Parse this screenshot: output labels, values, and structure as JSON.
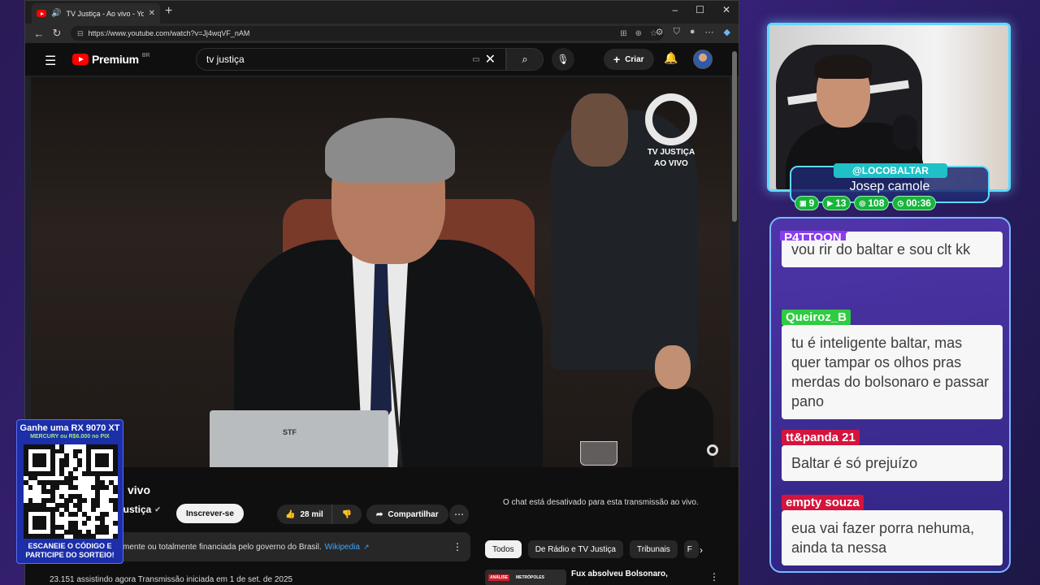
{
  "browser": {
    "tab_title": "TV Justiça - Ao vivo - YouTube",
    "url": "https://www.youtube.com/watch?v=Jj4wqVF_nAM"
  },
  "youtube": {
    "logo_text": "Premium",
    "country": "BR",
    "search_value": "tv justiça",
    "create_label": "Criar",
    "video": {
      "channel_logo_line1": "TV JUSTIÇA",
      "channel_logo_line2": "AO VIVO",
      "laptop_brand": "STF"
    },
    "title_partial": "vivo",
    "channel_name": "Justiça",
    "subscribe_label": "Inscrever-se",
    "likes": "28 mil",
    "share_label": "Compartilhar",
    "info_text": "mente ou totalmente financiada pelo governo do Brasil.",
    "info_link": "Wikipedia",
    "stats_text": "23.151 assistindo agora  Transmissão iniciada em 1 de set. de 2025",
    "chat_disabled": "O chat está desativado para esta transmissão ao vivo.",
    "chips": [
      "Todos",
      "De Rádio e TV Justiça",
      "Tribunais",
      "F"
    ],
    "recommendation": {
      "tag": "ANÁLISE",
      "source": "METRÓPOLES",
      "title": "Fux absolveu Bolsonaro,"
    }
  },
  "overlay": {
    "handle": "@LOCOBALTAR",
    "caption": "Josep camole",
    "stats": [
      {
        "icon": "twitch",
        "value": "9"
      },
      {
        "icon": "youtube",
        "value": "13"
      },
      {
        "icon": "kick",
        "value": "108"
      },
      {
        "icon": "clock",
        "value": "00:36"
      }
    ],
    "chat": [
      {
        "user": "P4TTOON",
        "text": "vou rir do baltar e sou clt kk",
        "color": "#8a3cf0"
      },
      {
        "user": "Queiroz_B",
        "text": "tu é inteligente baltar, mas quer tampar os olhos pras merdas do bolsonaro e passar pano",
        "color": "#2ecc40"
      },
      {
        "user": "tt&panda 21",
        "text": "Baltar é só prejuízo",
        "color": "#d4143c"
      },
      {
        "user": "empty souza",
        "text": "eua vai fazer porra nehuma, ainda ta nessa",
        "color": "#d4143c"
      }
    ]
  },
  "promo": {
    "title": "Ganhe uma RX 9070 XT",
    "subtitle": "MERCURY ou R$6.000 no PIX",
    "footer1": "ESCANEIE O CÓDIGO E",
    "footer2": "PARTICIPE DO SORTEIO!"
  }
}
